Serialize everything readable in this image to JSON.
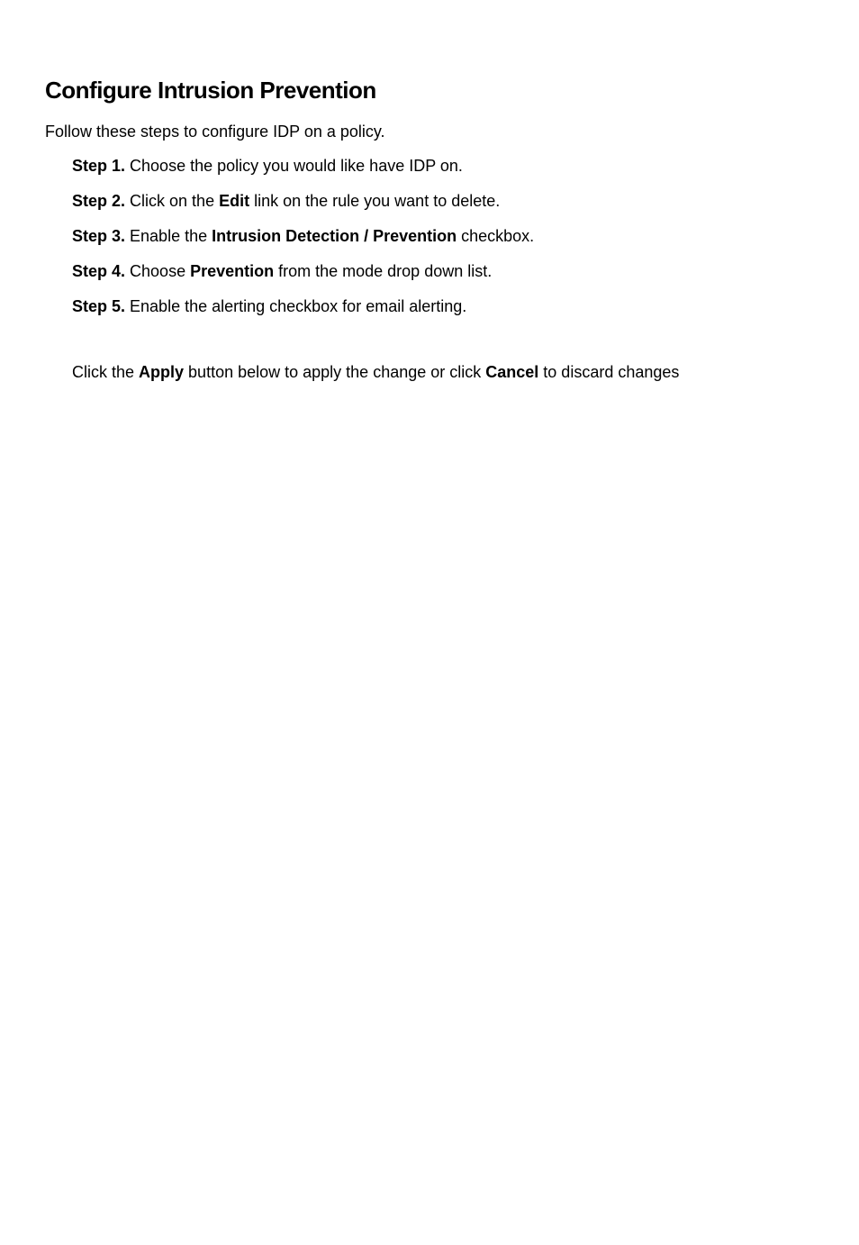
{
  "title": "Configure Intrusion Prevention",
  "intro": "Follow these steps to configure IDP on a policy.",
  "steps": [
    {
      "label": "Step 1.",
      "before": " Choose the policy you would like have IDP on.",
      "bold1": "",
      "middle": "",
      "bold2": "",
      "after": ""
    },
    {
      "label": "Step 2.",
      "before": " Click on the ",
      "bold1": "Edit",
      "middle": " link on the rule you want to delete.",
      "bold2": "",
      "after": ""
    },
    {
      "label": "Step 3.",
      "before": " Enable the ",
      "bold1": "Intrusion Detection / Prevention",
      "middle": " checkbox.",
      "bold2": "",
      "after": ""
    },
    {
      "label": "Step 4.",
      "before": " Choose ",
      "bold1": "Prevention",
      "middle": " from the mode drop down list.",
      "bold2": "",
      "after": ""
    },
    {
      "label": "Step 5.",
      "before": " Enable the alerting checkbox for email alerting.",
      "bold1": "",
      "middle": "",
      "bold2": "",
      "after": ""
    }
  ],
  "footer": {
    "before": "Click the ",
    "bold1": "Apply",
    "middle": " button below to apply the change or click ",
    "bold2": "Cancel",
    "after": " to discard changes"
  }
}
